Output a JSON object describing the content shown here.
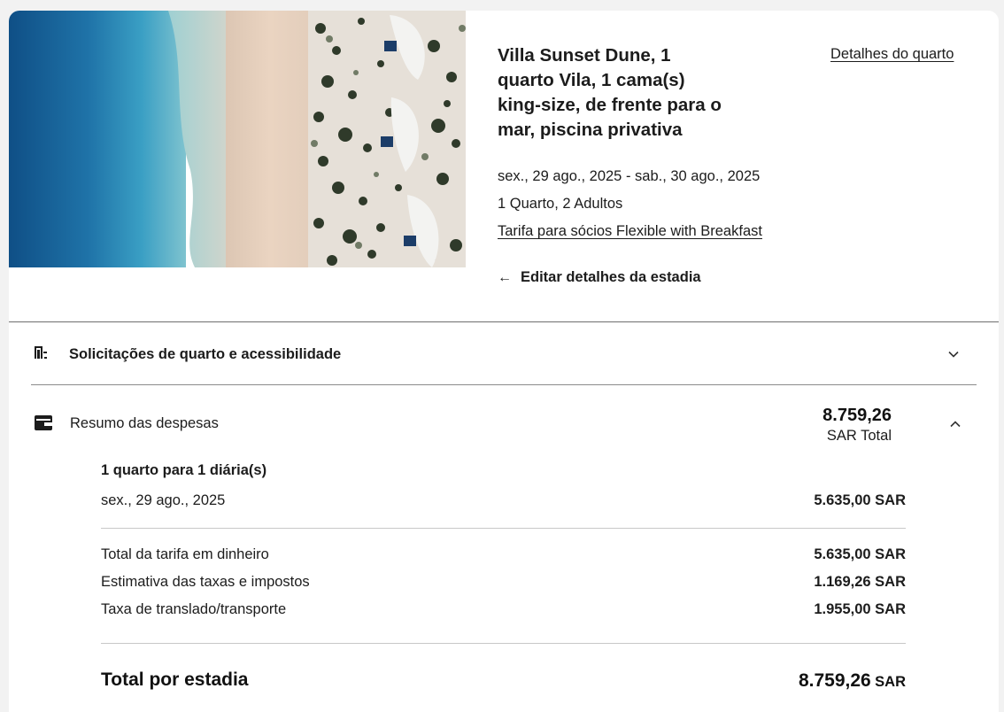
{
  "room": {
    "title": "Villa Sunset Dune, 1 quarto Vila, 1 cama(s) king-size, de frente para o mar, piscina privativa",
    "details_link": "Detalhes do quarto",
    "dates": "sex., 29 ago., 2025 - sab., 30 ago., 2025",
    "occupancy": "1 Quarto, 2 Adultos",
    "rate_link": "Tarifa para sócios Flexible with Breakfast",
    "edit_label": "Editar detalhes da estadia"
  },
  "requests": {
    "label": "Solicitações de quarto e acessibilidade",
    "icon": "door-icon"
  },
  "summary": {
    "label": "Resumo das despesas",
    "icon": "wallet-icon",
    "total_amount": "8.759,26",
    "total_currency": "SAR Total",
    "rooms_heading": "1 quarto para 1 diária(s)",
    "nights": [
      {
        "date": "sex., 29 ago., 2025",
        "amount": "5.635,00 SAR"
      }
    ],
    "lines": [
      {
        "label": "Total da tarifa em dinheiro",
        "amount": "5.635,00 SAR"
      },
      {
        "label": "Estimativa das taxas e impostos",
        "amount": "1.169,26 SAR"
      },
      {
        "label": "Taxa de translado/transporte",
        "amount": "1.955,00 SAR"
      }
    ],
    "grand_label": "Total por estadia",
    "grand_amount": "8.759,26",
    "grand_currency": "SAR"
  },
  "colors": {
    "background": "#f2f2f2",
    "card": "#ffffff",
    "text": "#1c1c1c",
    "sea": "#1e6f9f",
    "sand": "#e8d6c4"
  }
}
